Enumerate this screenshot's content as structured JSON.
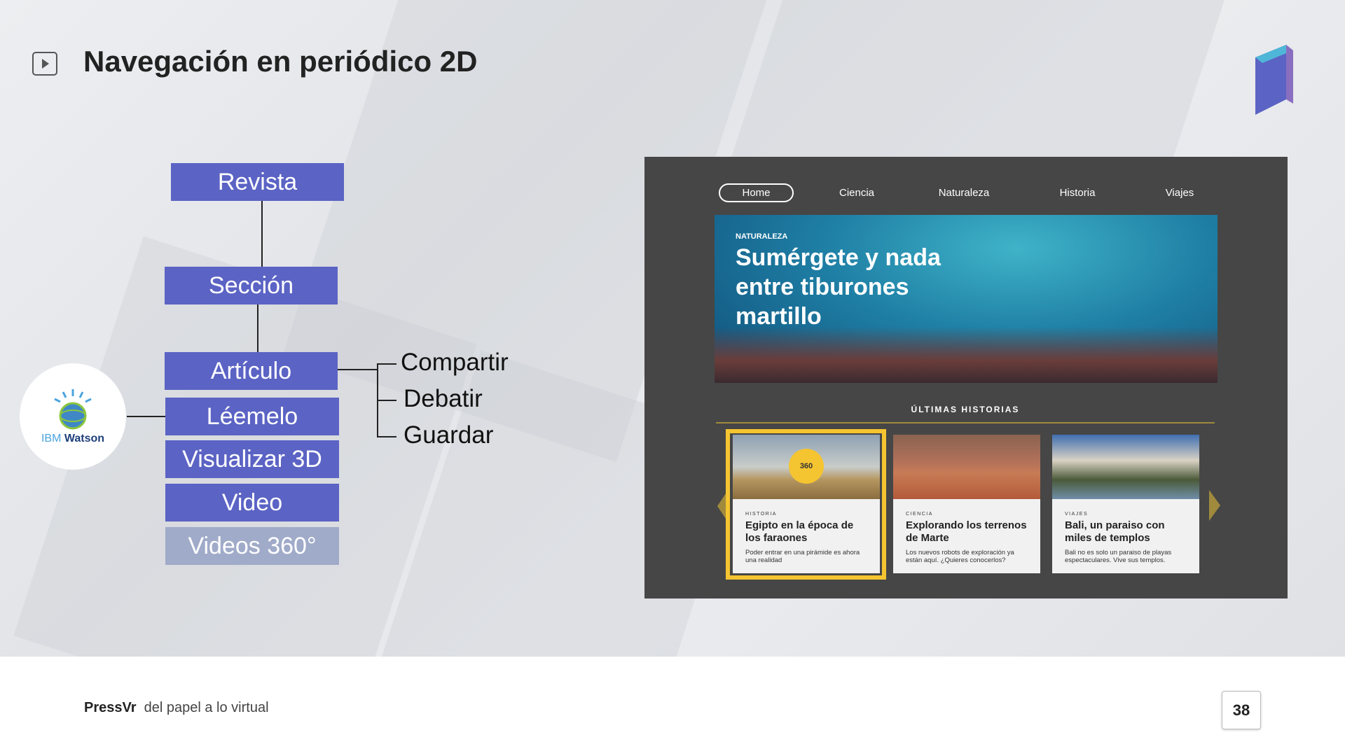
{
  "slide": {
    "title": "Navegación en periódico 2D",
    "page_number": "38"
  },
  "footer": {
    "brand": "PressVr",
    "tagline": "del papel a lo virtual"
  },
  "hierarchy": {
    "revista": "Revista",
    "seccion": "Sección",
    "articulo": "Artículo",
    "options": [
      "Léemelo",
      "Visualizar 3D",
      "Video",
      "Videos 360°"
    ],
    "actions": [
      "Compartir",
      "Debatir",
      "Guardar"
    ]
  },
  "watson": {
    "ibm": "IBM",
    "name": "Watson"
  },
  "app": {
    "nav": [
      "Home",
      "Ciencia",
      "Naturaleza",
      "Historia",
      "Viajes"
    ],
    "active_nav": "Home",
    "hero": {
      "category": "NATURALEZA",
      "title": "Sumérgete y nada entre tiburones martillo"
    },
    "section_title": "ÚLTIMAS HISTORIAS",
    "cards": [
      {
        "category": "HISTORIA",
        "title": "Egipto en la época de los faraones",
        "desc": "Poder entrar en una pirámide es ahora una realidad",
        "badge": "360"
      },
      {
        "category": "CIENCIA",
        "title": "Explorando los terrenos de Marte",
        "desc": "Los nuevos robots de exploración ya están aquí. ¿Quieres conocerlos?"
      },
      {
        "category": "VIAJES",
        "title": "Bali, un paraiso con miles de templos",
        "desc": "Bali no es solo un paraiso de playas espectaculares. Vive sus templos."
      }
    ]
  },
  "colors": {
    "box": "#5b63c4",
    "box_disabled": "#a0abc9",
    "accent": "#f5c431",
    "panel": "#464646"
  }
}
